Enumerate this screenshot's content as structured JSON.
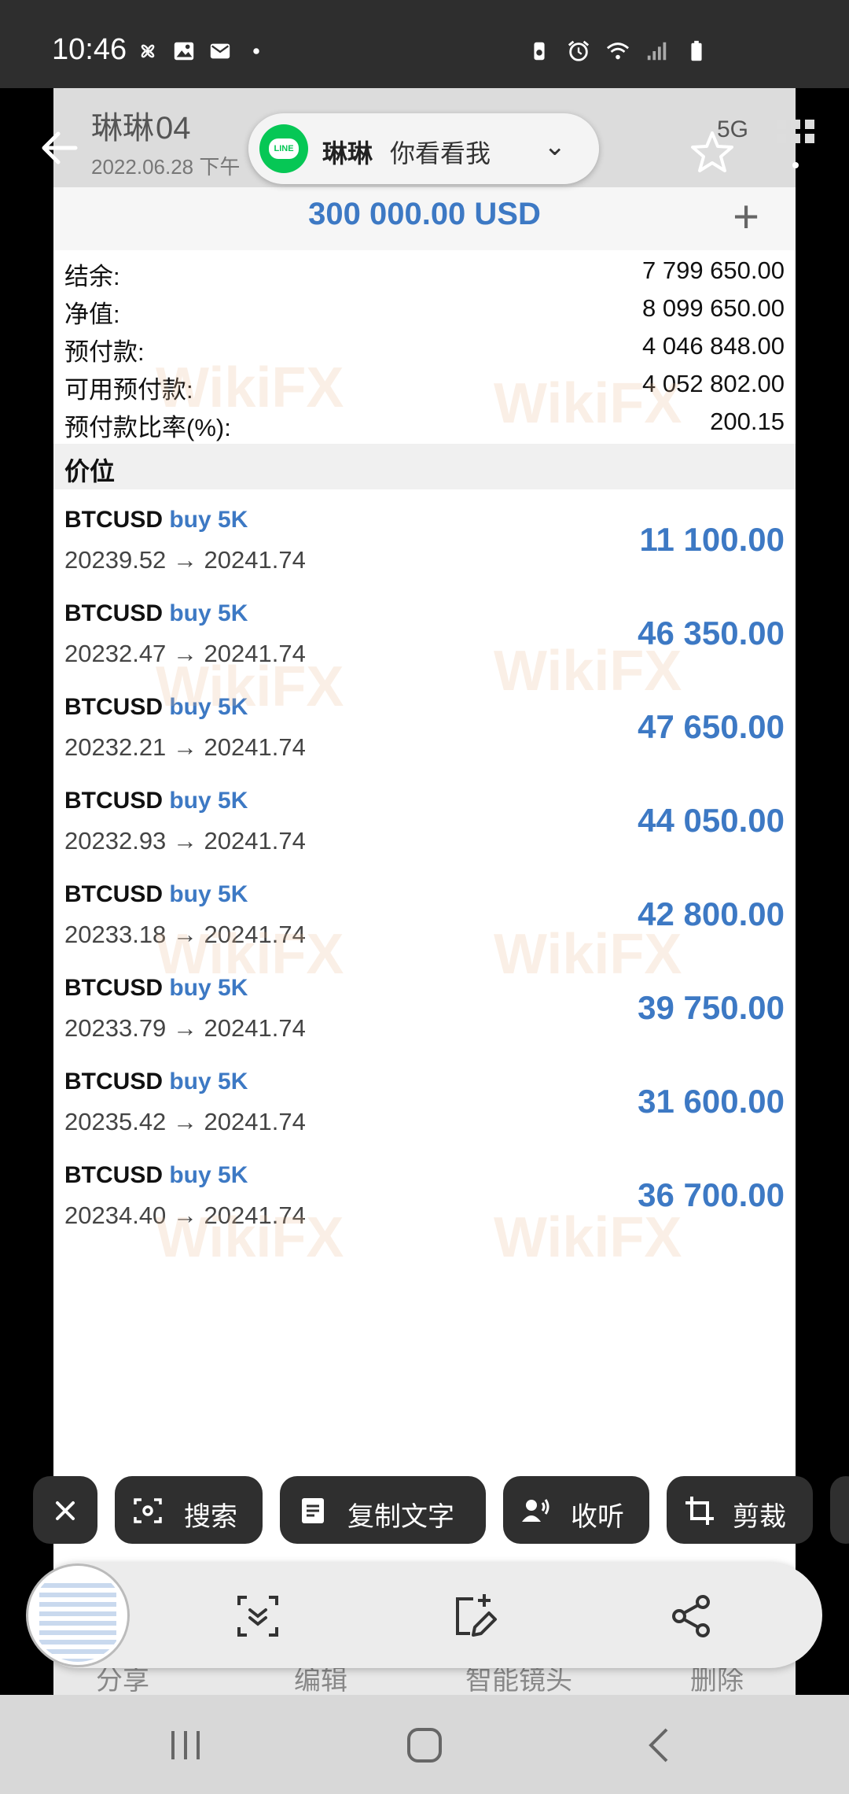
{
  "status_bar": {
    "time": "10:46"
  },
  "shot": {
    "contact_name": "琳琳",
    "clock_fragment": "04",
    "date": "2022.06.28 下午",
    "network": "5G",
    "amount": "300 000.00 USD",
    "summary": [
      {
        "label": "结余:",
        "value": "7 799 650.00"
      },
      {
        "label": "净值:",
        "value": "8 099 650.00"
      },
      {
        "label": "预付款:",
        "value": "4 046 848.00"
      },
      {
        "label": "可用预付款:",
        "value": "4 052 802.00"
      },
      {
        "label": "预付款比率(%):",
        "value": "200.15"
      }
    ],
    "section_title": "价位",
    "positions": [
      {
        "symbol": "BTCUSD",
        "side": "buy 5K",
        "prices": "20239.52 → 20241.74",
        "profit": "11 100.00"
      },
      {
        "symbol": "BTCUSD",
        "side": "buy 5K",
        "prices": "20232.47 → 20241.74",
        "profit": "46 350.00"
      },
      {
        "symbol": "BTCUSD",
        "side": "buy 5K",
        "prices": "20232.21 → 20241.74",
        "profit": "47 650.00"
      },
      {
        "symbol": "BTCUSD",
        "side": "buy 5K",
        "prices": "20232.93 → 20241.74",
        "profit": "44 050.00"
      },
      {
        "symbol": "BTCUSD",
        "side": "buy 5K",
        "prices": "20233.18 → 20241.74",
        "profit": "42 800.00"
      },
      {
        "symbol": "BTCUSD",
        "side": "buy 5K",
        "prices": "20233.79 → 20241.74",
        "profit": "39 750.00"
      },
      {
        "symbol": "BTCUSD",
        "side": "buy 5K",
        "prices": "20235.42 → 20241.74",
        "profit": "31 600.00"
      },
      {
        "symbol": "BTCUSD",
        "side": "buy 5K",
        "prices": "20234.40 → 20241.74",
        "profit": "36 700.00"
      }
    ]
  },
  "notification": {
    "app_badge": "LINE",
    "sender": "琳琳",
    "message": "你看看我"
  },
  "chips": {
    "search": "搜索",
    "copy_text": "复制文字",
    "listen": "收听",
    "crop": "剪裁"
  },
  "under_toolbar": {
    "share": "分享",
    "edit": "编辑",
    "smart_select": "智能镜头",
    "delete": "删除"
  },
  "watermark": "WikiFX",
  "colors": {
    "accent_blue": "#3d79c4",
    "line_green": "#06c755"
  }
}
